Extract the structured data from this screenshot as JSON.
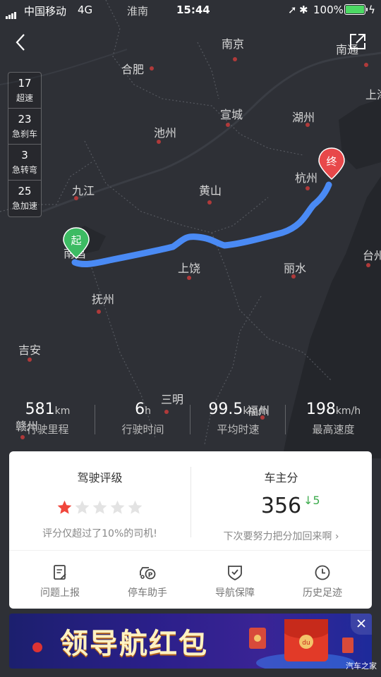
{
  "status_bar": {
    "carrier": "中国移动",
    "network": "4G",
    "time": "15:44",
    "battery": "100%",
    "battery_level": 1.0,
    "map_label_city": "淮南"
  },
  "map": {
    "cities": [
      "南京",
      "合肥",
      "南通",
      "上海",
      "宣城",
      "湖州",
      "池州",
      "杭州",
      "九江",
      "黄山",
      "南昌",
      "上饶",
      "丽水",
      "台州",
      "抚州",
      "吉安",
      "三明",
      "赣州",
      "福州"
    ],
    "start_label": "起",
    "end_label": "终",
    "route_color": "#4a8af4",
    "start_color": "#3dbb63",
    "end_color": "#e8484a"
  },
  "events": [
    {
      "count": "17",
      "label": "超速"
    },
    {
      "count": "23",
      "label": "急刹车"
    },
    {
      "count": "3",
      "label": "急转弯"
    },
    {
      "count": "25",
      "label": "急加速"
    }
  ],
  "summary": [
    {
      "value": "581",
      "unit": "km",
      "label": "行驶里程"
    },
    {
      "value": "6",
      "unit": "h",
      "label": "行驶时间"
    },
    {
      "value": "99.5",
      "unit": "km/h",
      "label": "平均时速"
    },
    {
      "value": "198",
      "unit": "km/h",
      "label": "最高速度"
    }
  ],
  "rating": {
    "title": "驾驶评级",
    "stars_filled": 1,
    "stars_total": 5,
    "note": "评分仅超过了10%的司机!"
  },
  "owner_score": {
    "title": "车主分",
    "score": "356",
    "delta": "↓5",
    "note": "下次要努力把分加回来啊"
  },
  "actions": [
    {
      "label": "问题上报",
      "icon": "report-icon"
    },
    {
      "label": "停车助手",
      "icon": "parking-icon"
    },
    {
      "label": "导航保障",
      "icon": "shield-check-icon"
    },
    {
      "label": "历史足迹",
      "icon": "clock-icon"
    }
  ],
  "banner": {
    "text": "领导航红包"
  },
  "watermark": "汽车之家",
  "colors": {
    "accent_red": "#e8484a",
    "delta_green": "#3dab4d",
    "star_active": "#f0463c",
    "star_inactive": "#e3e3e3"
  }
}
